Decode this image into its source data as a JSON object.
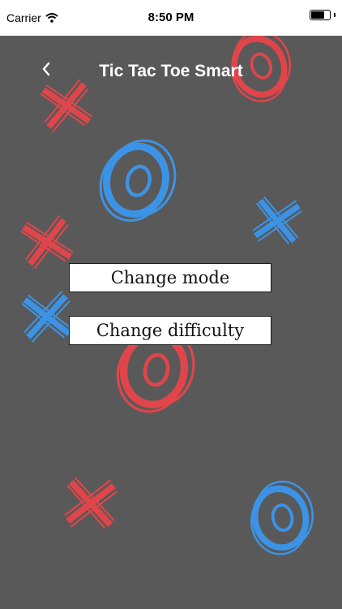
{
  "status_bar": {
    "carrier": "Carrier",
    "time": "8:50 PM",
    "battery_level": 0.8,
    "wifi_icon": "wifi-icon",
    "battery_icon": "battery-icon"
  },
  "nav": {
    "title": "Tic Tac Toe Smart",
    "back_icon": "chevron-left-icon"
  },
  "menu": {
    "change_mode_label": "Change mode",
    "change_difficulty_label": "Change difficulty"
  },
  "colors": {
    "background": "#595959",
    "x_red": "#e0454a",
    "o_blue": "#3c93e6",
    "button_bg": "#ffffff"
  }
}
